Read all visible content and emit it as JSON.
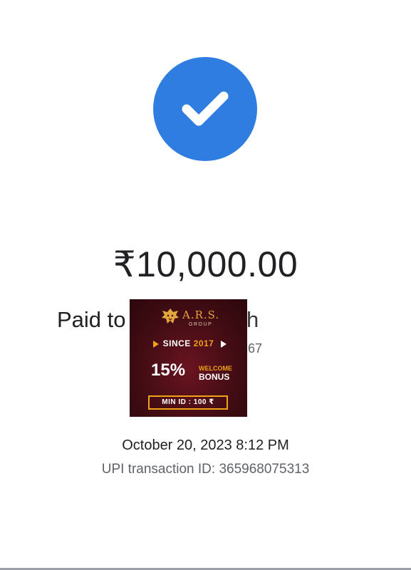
{
  "payment": {
    "amount": "₹10,000.00",
    "paid_to_label": "Paid to",
    "recipient_name_partial": "h",
    "recipient_id_partial": "67",
    "datetime": "October 20, 2023 8:12 PM",
    "upi_transaction_id": "UPI transaction ID: 365968075313"
  },
  "ad_banner": {
    "brand": "A.R.S.",
    "brand_sub": "GROUP",
    "since_label": "SINCE ",
    "since_year": "2017",
    "bonus_percent": "15%",
    "welcome": "WELCOME",
    "bonus": "BONUS",
    "min_id": "MIN ID : 100 ₹"
  },
  "icons": {
    "success": "check-icon",
    "ad_logo": "lion-icon"
  },
  "colors": {
    "success_circle": "#2f7de1",
    "ad_background": "#4a0e16",
    "ad_accent": "#f0a21a",
    "text_primary": "#202124",
    "text_secondary": "#5f6368"
  }
}
